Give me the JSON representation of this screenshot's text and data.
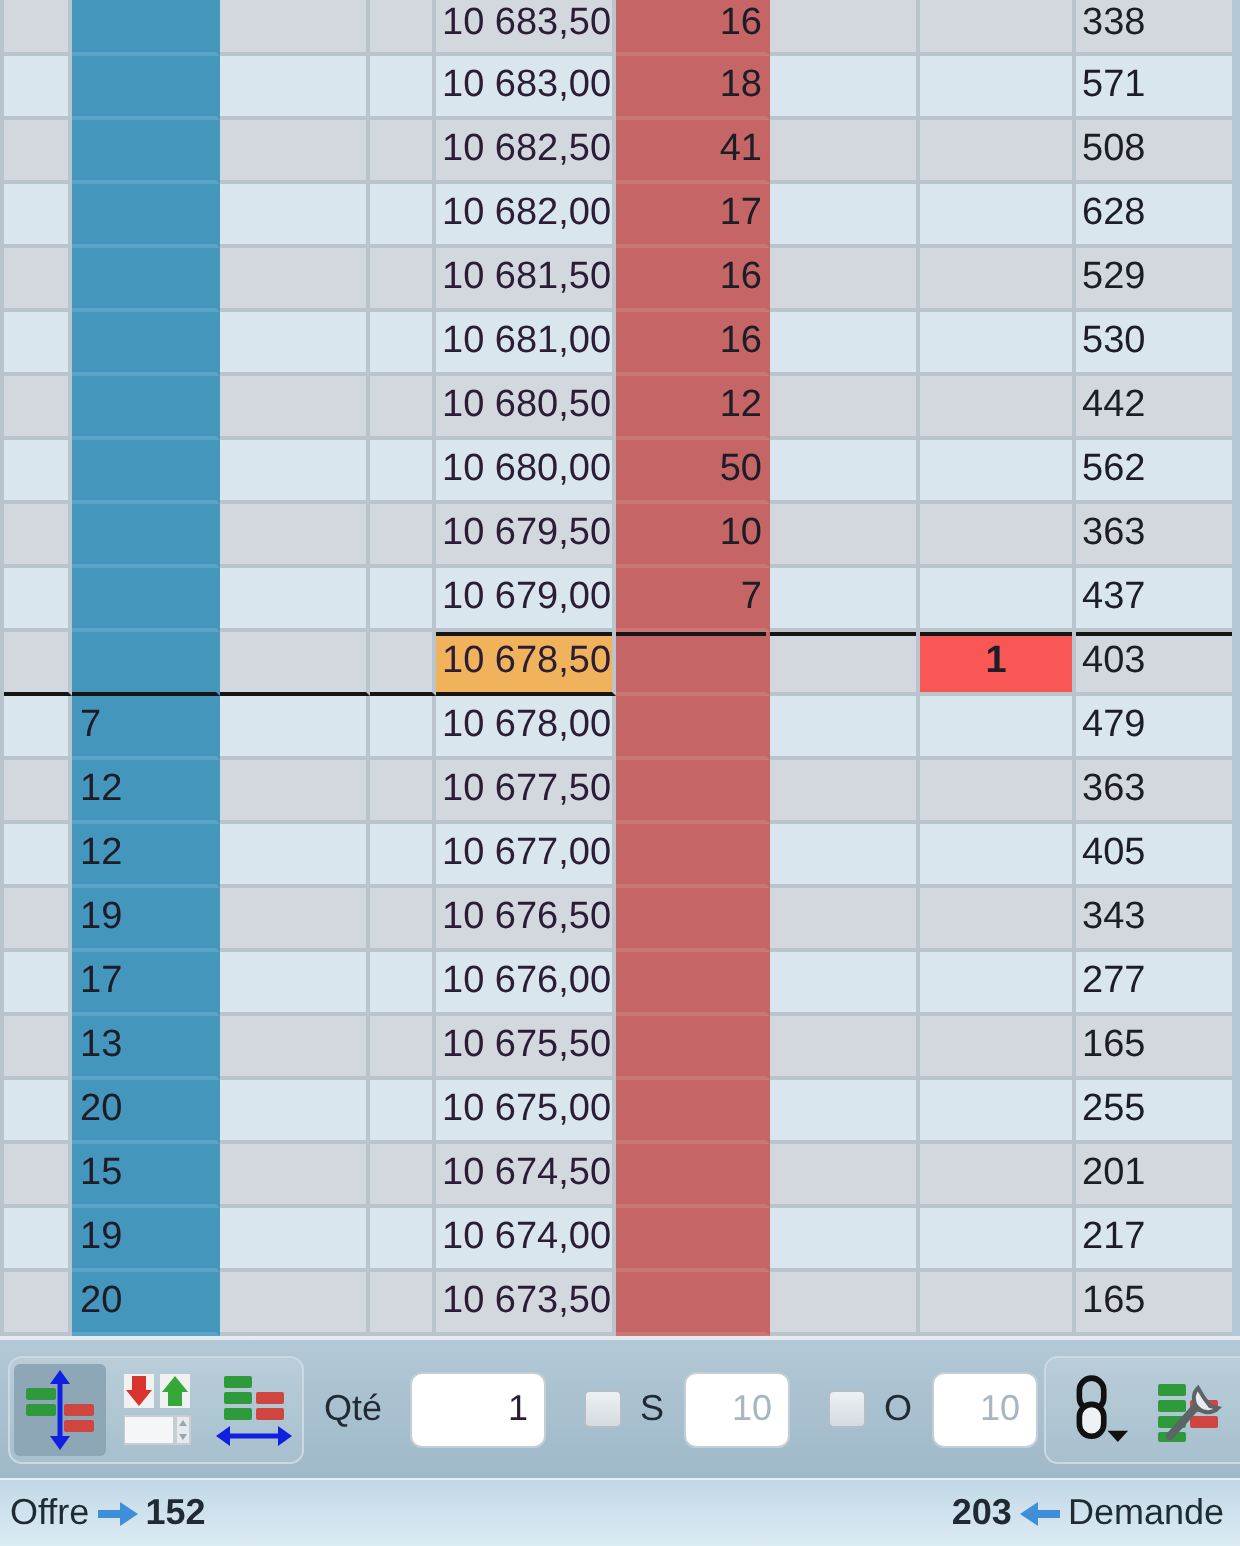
{
  "table": {
    "rows": [
      {
        "price": "10 683,50",
        "column_6": "16",
        "column_9": "338",
        "highlighted": false
      },
      {
        "price": "10 683,00",
        "column_6": "18",
        "column_9": "571",
        "highlighted": false
      },
      {
        "price": "10 682,50",
        "column_6": "41",
        "column_9": "508",
        "highlighted": false
      },
      {
        "price": "10 682,00",
        "column_6": "17",
        "column_9": "628",
        "highlighted": false
      },
      {
        "price": "10 681,50",
        "column_6": "16",
        "column_9": "529",
        "highlighted": false
      },
      {
        "price": "10 681,00",
        "column_6": "16",
        "column_9": "530",
        "highlighted": false
      },
      {
        "price": "10 680,50",
        "column_6": "12",
        "column_9": "442",
        "highlighted": false
      },
      {
        "price": "10 680,00",
        "column_6": "50",
        "column_9": "562",
        "highlighted": false
      },
      {
        "price": "10 679,50",
        "column_6": "10",
        "column_9": "363",
        "highlighted": false
      },
      {
        "price": "10 679,00",
        "column_6": "7",
        "column_9": "437",
        "highlighted": false
      },
      {
        "price": "10 678,50",
        "column_8": "1",
        "column_9": "403",
        "highlighted": true
      },
      {
        "column_2": "7",
        "price": "10 678,00",
        "column_9": "479",
        "highlighted": false
      },
      {
        "column_2": "12",
        "price": "10 677,50",
        "column_9": "363",
        "highlighted": false
      },
      {
        "column_2": "12",
        "price": "10 677,00",
        "column_9": "405",
        "highlighted": false
      },
      {
        "column_2": "19",
        "price": "10 676,50",
        "column_9": "343",
        "highlighted": false
      },
      {
        "column_2": "17",
        "price": "10 676,00",
        "column_9": "277",
        "highlighted": false
      },
      {
        "column_2": "13",
        "price": "10 675,50",
        "column_9": "165",
        "highlighted": false
      },
      {
        "column_2": "20",
        "price": "10 675,00",
        "column_9": "255",
        "highlighted": false
      },
      {
        "column_2": "15",
        "price": "10 674,50",
        "column_9": "201",
        "highlighted": false
      },
      {
        "column_2": "19",
        "price": "10 674,00",
        "column_9": "217",
        "highlighted": false
      },
      {
        "column_2": "20",
        "price": "10 673,50",
        "column_9": "165",
        "highlighted": false
      }
    ]
  },
  "toolbar": {
    "view_buttons": [
      {
        "selected": true
      },
      {
        "selected": false
      },
      {
        "selected": false
      }
    ],
    "quantity": {
      "label": "Qté",
      "value": "1"
    },
    "options": [
      {
        "label": "S",
        "checked": false,
        "value": "10",
        "disabled": true
      },
      {
        "label": "O",
        "checked": false,
        "value": "10",
        "disabled": true
      }
    ]
  },
  "status_bar": {
    "left": {
      "label": "Offre",
      "value": "152"
    },
    "right": {
      "value": "203",
      "label": "Demande"
    }
  }
}
